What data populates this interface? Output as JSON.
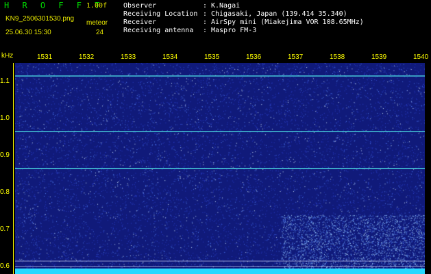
{
  "header": {
    "app_title": "H R O F F T",
    "version": "1.00f",
    "filename": "KN9_2506301530.png",
    "mode": "meteor",
    "datetime": "25.06.30 15:30",
    "count": "24",
    "info": [
      {
        "label": "Observer",
        "value": "K.Nagai"
      },
      {
        "label": "Receiving Location",
        "value": "Chigasaki, Japan (139.414 35.340)"
      },
      {
        "label": "Receiver",
        "value": "AirSpy mini (Miakejima VOR 108.65MHz)"
      },
      {
        "label": "Receiving antenna",
        "value": "Maspro FM-3"
      }
    ],
    "separator": ":"
  },
  "chart_data": {
    "type": "heatmap",
    "x_ticks": [
      "1531",
      "1532",
      "1533",
      "1534",
      "1535",
      "1536",
      "1537",
      "1538",
      "1539",
      "1540"
    ],
    "y_unit": "kHz",
    "y_ticks": [
      "1.1",
      "1.0",
      "0.9",
      "0.8",
      "0.7",
      "0.6"
    ],
    "ylim": [
      0.58,
      1.15
    ],
    "horizontal_lines_khz": [
      1.115,
      0.965,
      0.865
    ],
    "colors": {
      "background": "#101a7a",
      "line": "#4ad6e0",
      "tick": "#ffff00",
      "band": "#27d8ff"
    }
  }
}
